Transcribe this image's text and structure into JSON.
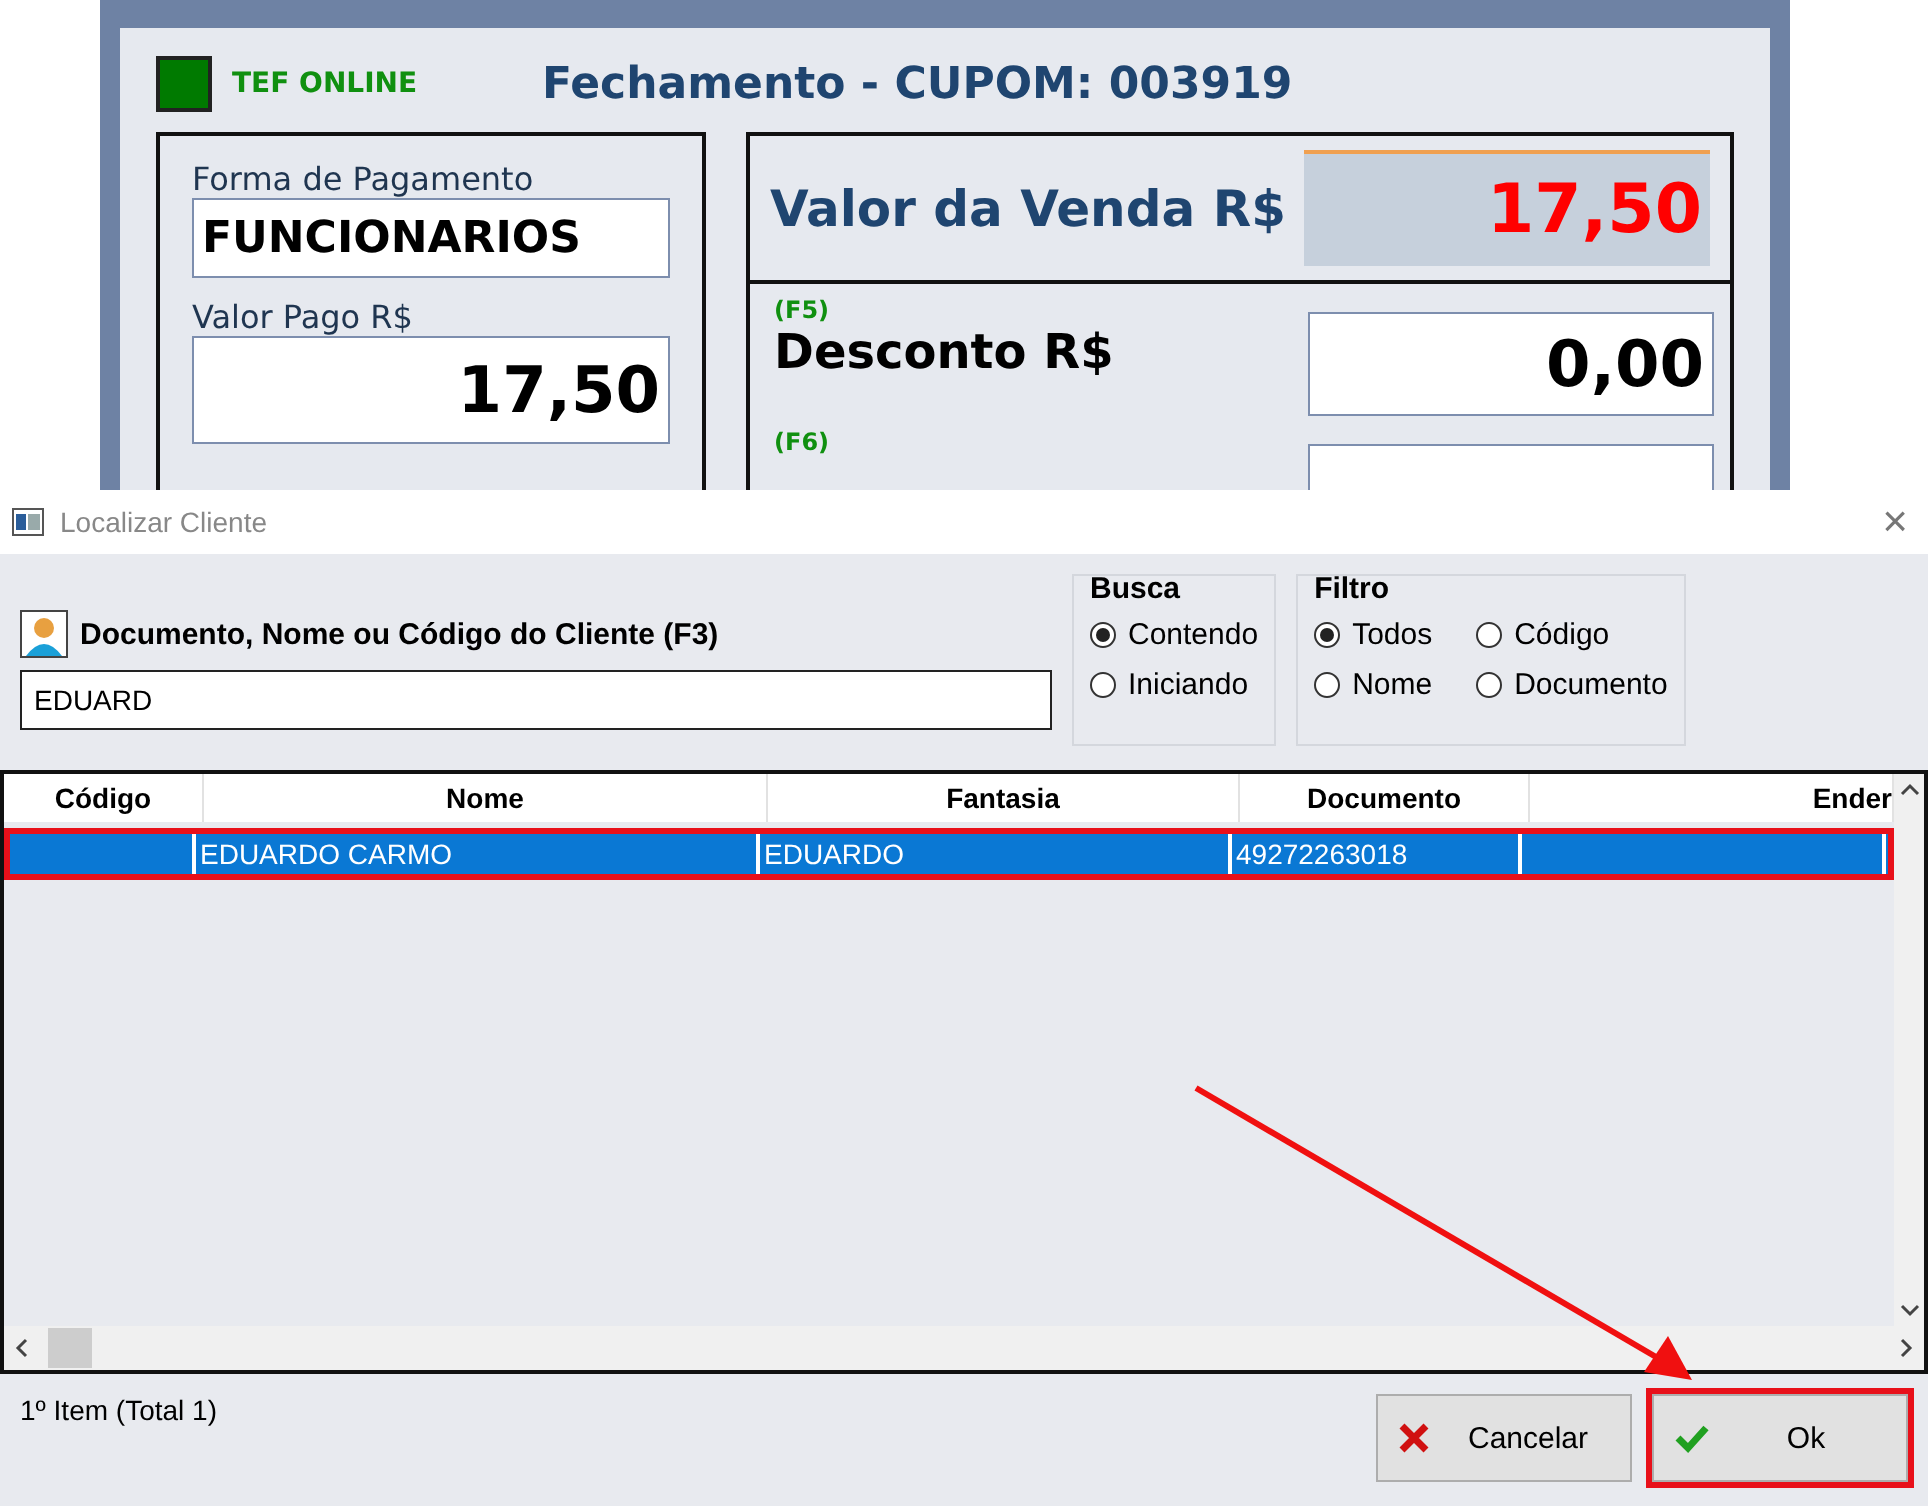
{
  "background_window": {
    "tef_status": {
      "label": "TEF ONLINE",
      "online": true
    },
    "title": "Fechamento - CUPOM: 003919",
    "payment": {
      "method_label": "Forma de Pagamento",
      "method_value": "FUNCIONARIOS",
      "paid_label": "Valor Pago R$",
      "paid_value": "17,50"
    },
    "totals": {
      "sale_label": "Valor da Venda R$",
      "sale_value": "17,50",
      "fields": [
        {
          "key": "(F5)",
          "label": "Desconto R$",
          "value": "0,00"
        },
        {
          "key": "(F6)"
        }
      ]
    }
  },
  "dialog": {
    "title": "Localizar Cliente",
    "close": "×",
    "search": {
      "label": "Documento, Nome ou Código do Cliente (F3)",
      "value": "EDUARD"
    },
    "busca": {
      "title": "Busca",
      "options": [
        {
          "label": "Contendo",
          "selected": true
        },
        {
          "label": "Iniciando",
          "selected": false
        }
      ]
    },
    "filtro": {
      "title": "Filtro",
      "options": [
        {
          "label": "Todos",
          "selected": true
        },
        {
          "label": "Código",
          "selected": false
        },
        {
          "label": "Nome",
          "selected": false
        },
        {
          "label": "Documento",
          "selected": false
        }
      ]
    },
    "table": {
      "columns": [
        "Código",
        "Nome",
        "Fantasia",
        "Documento",
        "Ender"
      ],
      "rows": [
        {
          "cells": [
            "",
            "EDUARDO CARMO",
            "EDUARDO",
            "49272263018",
            ""
          ],
          "selected": true,
          "highlighted": true
        }
      ]
    },
    "status": "1º Item (Total 1)",
    "buttons": [
      {
        "kind": "cancel",
        "label": "Cancelar",
        "highlighted": false
      },
      {
        "kind": "ok",
        "label": "Ok",
        "highlighted": true
      }
    ]
  },
  "annotation": {
    "arrow": true
  }
}
